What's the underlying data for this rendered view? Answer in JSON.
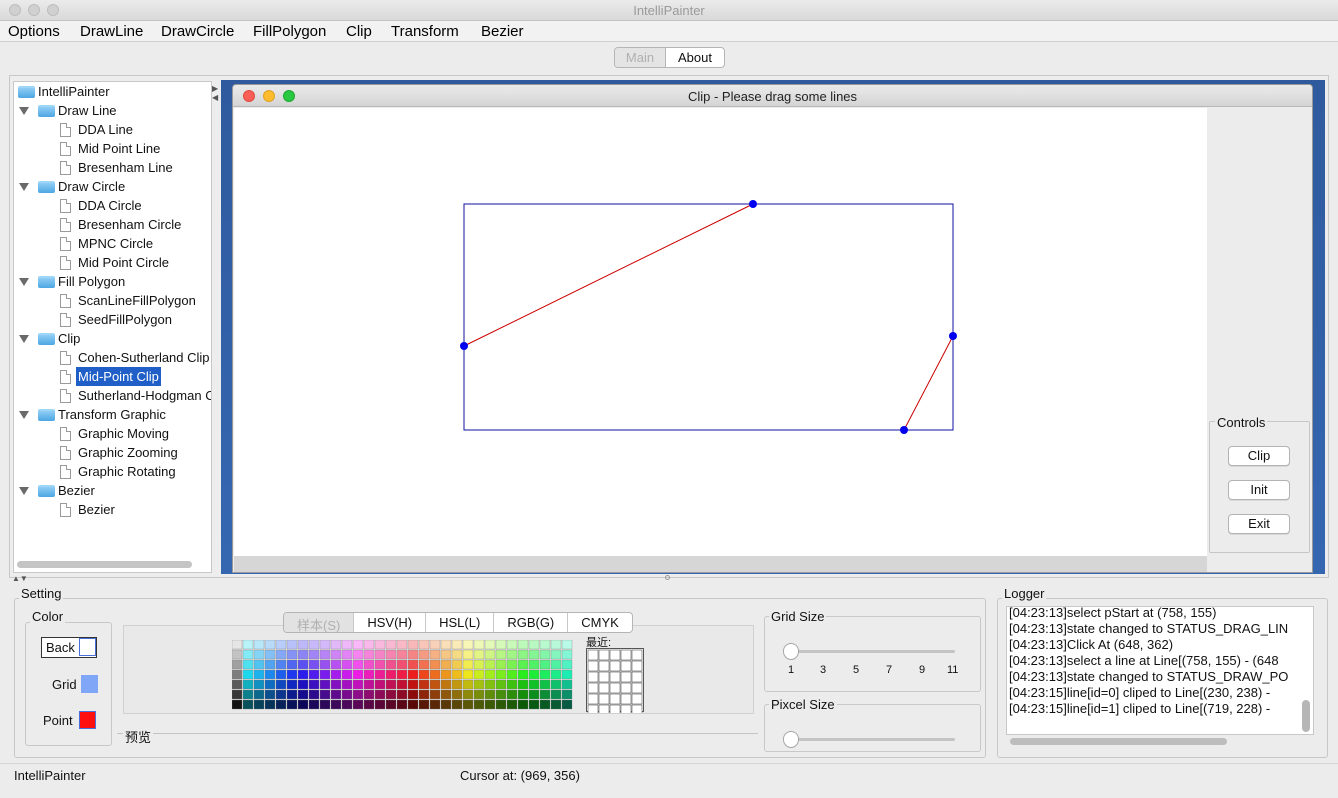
{
  "window": {
    "title": "IntelliPainter"
  },
  "menubar": [
    "Options",
    "DrawLine",
    "DrawCircle",
    "FillPolygon",
    "Clip",
    "Transform",
    "Bezier"
  ],
  "top_tabs": {
    "active": "Main",
    "other": "About"
  },
  "tree": {
    "root": "IntelliPainter",
    "groups": [
      {
        "label": "Draw Line",
        "items": [
          "DDA Line",
          "Mid Point Line",
          "Bresenham Line"
        ]
      },
      {
        "label": "Draw Circle",
        "items": [
          "DDA Circle",
          "Bresenham Circle",
          "MPNC Circle",
          "Mid Point Circle"
        ]
      },
      {
        "label": "Fill Polygon",
        "items": [
          "ScanLineFillPolygon",
          "SeedFillPolygon"
        ]
      },
      {
        "label": "Clip",
        "items": [
          "Cohen-Sutherland Clip",
          "Mid-Point Clip",
          "Sutherland-Hodgman C"
        ]
      },
      {
        "label": "Transform Graphic",
        "items": [
          "Graphic Moving",
          "Graphic Zooming",
          "Graphic Rotating"
        ]
      },
      {
        "label": "Bezier",
        "items": [
          "Bezier"
        ]
      }
    ],
    "selected": "Mid-Point Clip"
  },
  "clip_window": {
    "title": "Clip - Please drag some lines",
    "controls_label": "Controls",
    "buttons": [
      "Clip",
      "Init",
      "Exit"
    ]
  },
  "canvas": {
    "rect_color": "#1010a0",
    "line_color": "#cc0000",
    "point_color": "#0000ee"
  },
  "setting": {
    "label": "Setting",
    "color_label": "Color",
    "back_label": "Back",
    "grid_label": "Grid",
    "point_label": "Point",
    "grid_color": "#7fa6f7",
    "point_color": "#ff1010",
    "color_tabs": [
      "样本(S)",
      "HSV(H)",
      "HSL(L)",
      "RGB(G)",
      "CMYK"
    ],
    "recent_label": "最近:",
    "preview_label": "预览",
    "grid_size_label": "Grid Size",
    "grid_size_ticks": [
      "1",
      "3",
      "5",
      "7",
      "9",
      "11"
    ],
    "pixel_size_label": "Pixcel Size"
  },
  "logger": {
    "label": "Logger",
    "lines": [
      "[04:23:13]select pStart at (758, 155)",
      "[04:23:13]state changed to STATUS_DRAG_LIN",
      "[04:23:13]Click At (648, 362)",
      "[04:23:13]select a line at Line[(758, 155) - (648",
      "[04:23:13]state changed to STATUS_DRAW_PO",
      "[04:23:15]line[id=0] cliped to Line[(230, 238) -",
      "[04:23:15]line[id=1] cliped to Line[(719, 228) -"
    ]
  },
  "status": {
    "left": "IntelliPainter",
    "cursor": "Cursor at: (969, 356)"
  }
}
